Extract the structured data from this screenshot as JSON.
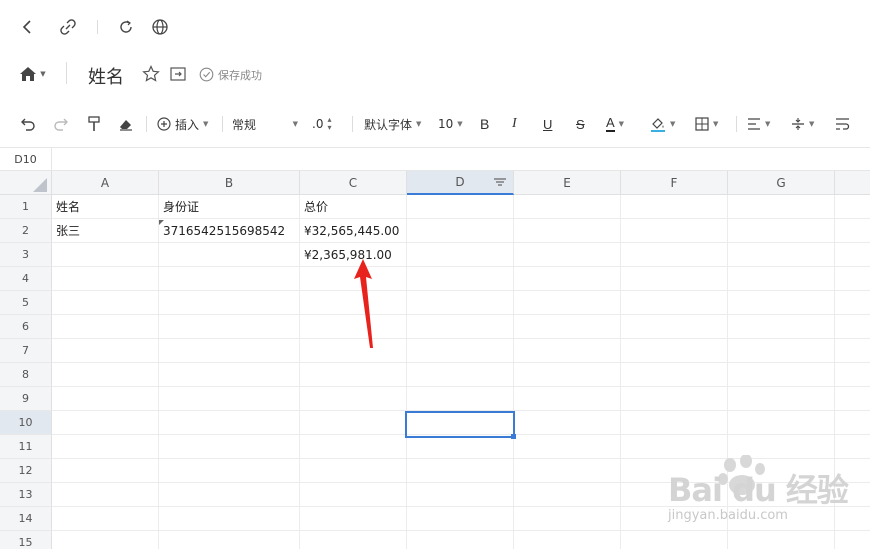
{
  "title": "姓名",
  "save_status": "保存成功",
  "toolbar": {
    "insert": "插入",
    "format": "常规",
    "decimal": ".0",
    "font": "默认字体",
    "size": "10"
  },
  "name_box": "D10",
  "columns": [
    "A",
    "B",
    "C",
    "D",
    "E",
    "F",
    "G"
  ],
  "rows": [
    "1",
    "2",
    "3",
    "4",
    "5",
    "6",
    "7",
    "8",
    "9",
    "10",
    "11",
    "12",
    "13",
    "14",
    "15"
  ],
  "cells": {
    "A1": "姓名",
    "B1": "身份证",
    "C1": "总价",
    "A2": "张三",
    "B2": "3716542515698542",
    "C2": "¥32,565,445.00",
    "C3": "¥2,365,981.00"
  },
  "colors": {
    "accent": "#3a7bd5",
    "arrow": "#e8231d"
  },
  "watermark": {
    "main": "Bai du 经验",
    "sub": "jingyan.baidu.com"
  }
}
